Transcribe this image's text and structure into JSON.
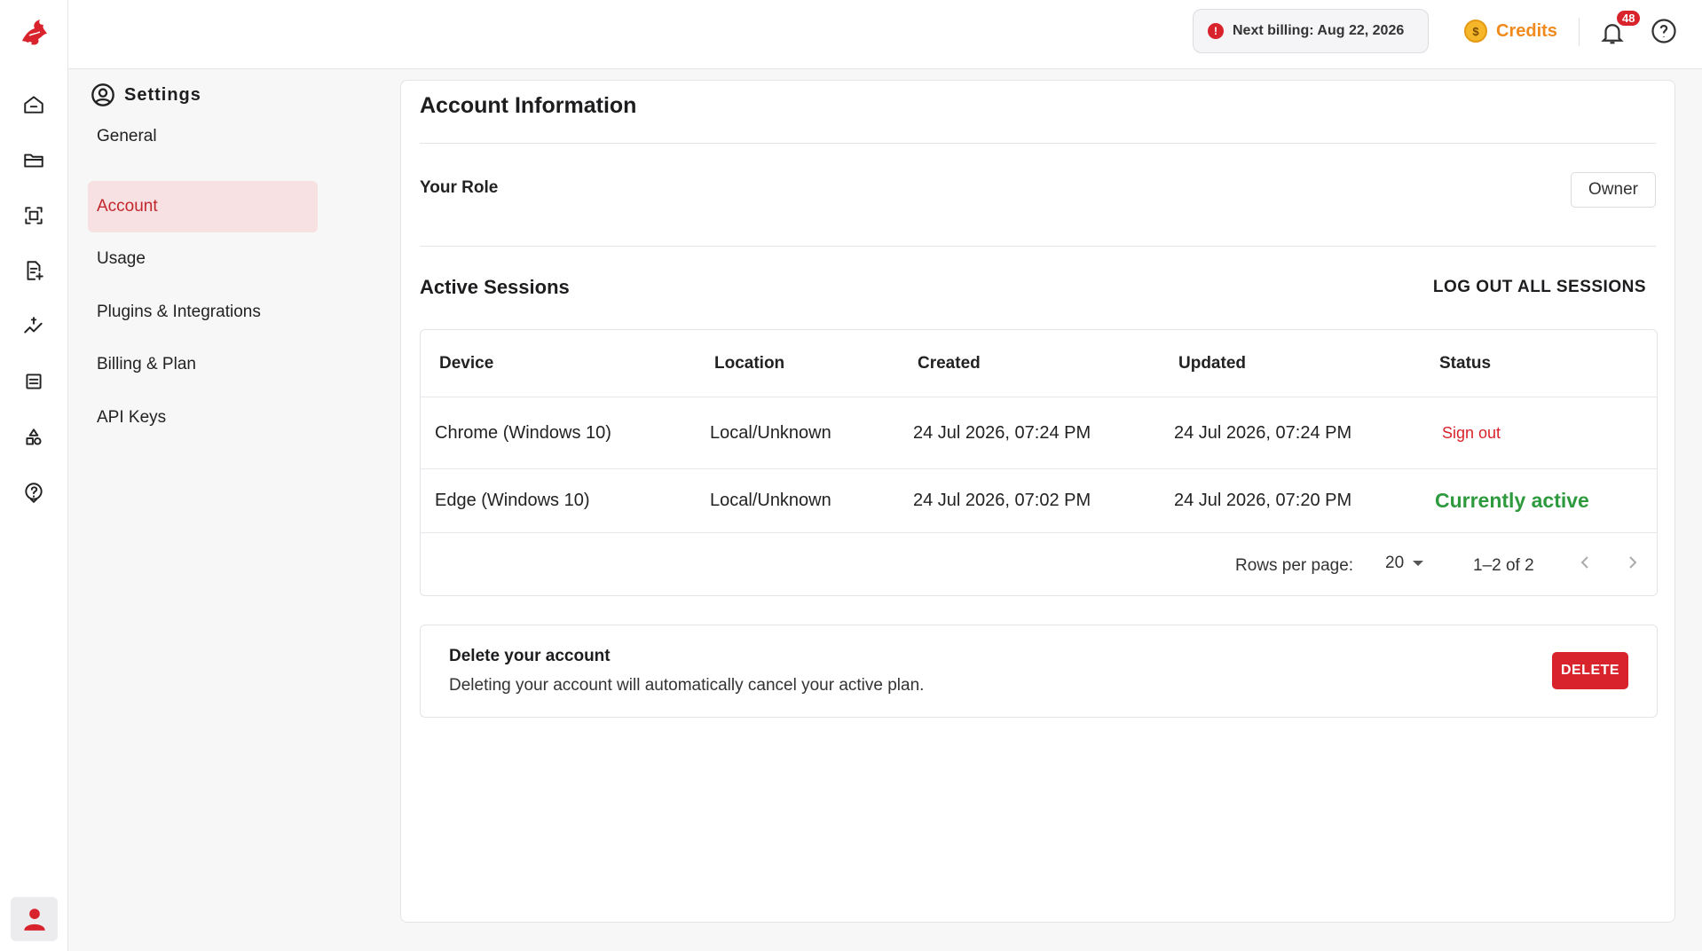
{
  "topbar": {
    "billing_text": "Next billing: Aug 22, 2026",
    "credits_label": "Credits",
    "notifications_count": "48"
  },
  "settings": {
    "title": "Settings",
    "items": [
      {
        "label": "General"
      },
      {
        "label": "Account"
      },
      {
        "label": "Usage"
      },
      {
        "label": "Plugins & Integrations"
      },
      {
        "label": "Billing & Plan"
      },
      {
        "label": "API Keys"
      }
    ],
    "active_index": 1
  },
  "account": {
    "title": "Account Information",
    "role_label": "Your Role",
    "role_value": "Owner"
  },
  "sessions": {
    "title": "Active Sessions",
    "logout_all_label": "LOG OUT ALL SESSIONS",
    "columns": [
      "Device",
      "Location",
      "Created",
      "Updated",
      "Status"
    ],
    "rows": [
      {
        "device": "Chrome (Windows 10)",
        "location": "Local/Unknown",
        "created": "24 Jul 2026, 07:24 PM",
        "updated": "24 Jul 2026, 07:24 PM",
        "status": "Sign out"
      },
      {
        "device": "Edge (Windows 10)",
        "location": "Local/Unknown",
        "created": "24 Jul 2026, 07:02 PM",
        "updated": "24 Jul 2026, 07:20 PM",
        "status": "Currently active"
      }
    ],
    "rows_per_page_label": "Rows per page:",
    "rows_per_page_value": "20",
    "range_text": "1–2 of 2"
  },
  "delete_account": {
    "title": "Delete your account",
    "description": "Deleting your account will automatically cancel your active plan.",
    "button_label": "DELETE"
  },
  "colors": {
    "brand_red": "#d9232c",
    "active_green": "#2e9a3e",
    "credits_orange": "#f08a1c"
  }
}
